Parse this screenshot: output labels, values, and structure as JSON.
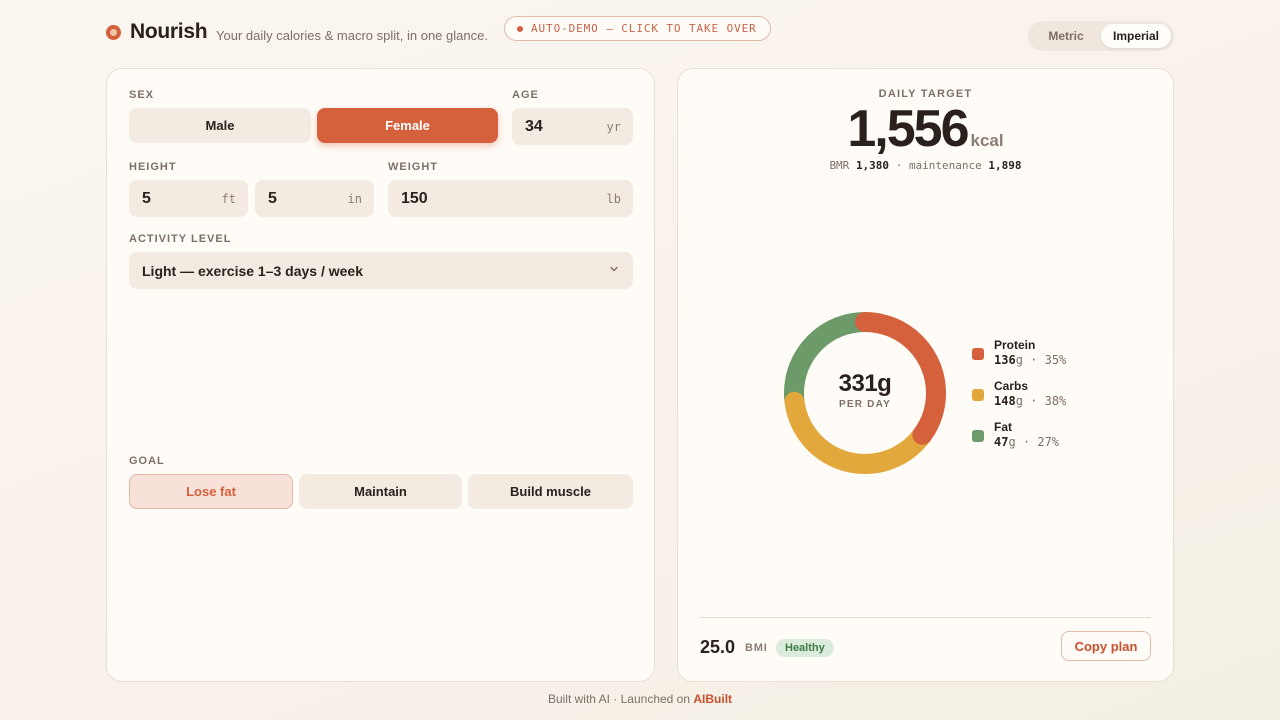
{
  "header": {
    "brand": "Nourish",
    "tagline": "Your daily calories & macro split, in one glance.",
    "demo_pill": "AUTO-DEMO — CLICK TO TAKE OVER",
    "units": {
      "metric": "Metric",
      "imperial": "Imperial",
      "selected": "Imperial"
    }
  },
  "form": {
    "sex": {
      "label": "SEX",
      "options": [
        "Male",
        "Female"
      ],
      "selected": "Female"
    },
    "age": {
      "label": "AGE",
      "value": "34",
      "unit": "yr"
    },
    "height": {
      "label": "HEIGHT",
      "ft": "5",
      "ft_unit": "ft",
      "in": "5",
      "in_unit": "in"
    },
    "weight": {
      "label": "WEIGHT",
      "value": "150",
      "unit": "lb"
    },
    "activity": {
      "label": "ACTIVITY LEVEL",
      "value": "Light — exercise 1–3 days / week"
    },
    "goal": {
      "label": "GOAL",
      "options": [
        "Lose fat",
        "Maintain",
        "Build muscle"
      ],
      "selected": "Lose fat"
    }
  },
  "result": {
    "target_label": "DAILY TARGET",
    "kcal": "1,556",
    "kcal_unit": "kcal",
    "bmr_label": "BMR",
    "bmr": "1,380",
    "maint_label": "maintenance",
    "maintenance": "1,898",
    "total": "331g",
    "total_sub": "PER DAY",
    "macros": [
      {
        "name": "Protein",
        "grams": "136",
        "pct": "35%",
        "fraction": 0.35,
        "color": "#d4603c"
      },
      {
        "name": "Carbs",
        "grams": "148",
        "pct": "38%",
        "fraction": 0.38,
        "color": "#e2a83c"
      },
      {
        "name": "Fat",
        "grams": "47",
        "pct": "27%",
        "fraction": 0.27,
        "color": "#6c9a68"
      }
    ],
    "bmi": "25.0",
    "bmi_label": "BMI",
    "bmi_status": "Healthy",
    "copy_label": "Copy plan"
  },
  "footer": {
    "text": "Built with AI · Launched on",
    "link": "AIBuilt"
  }
}
